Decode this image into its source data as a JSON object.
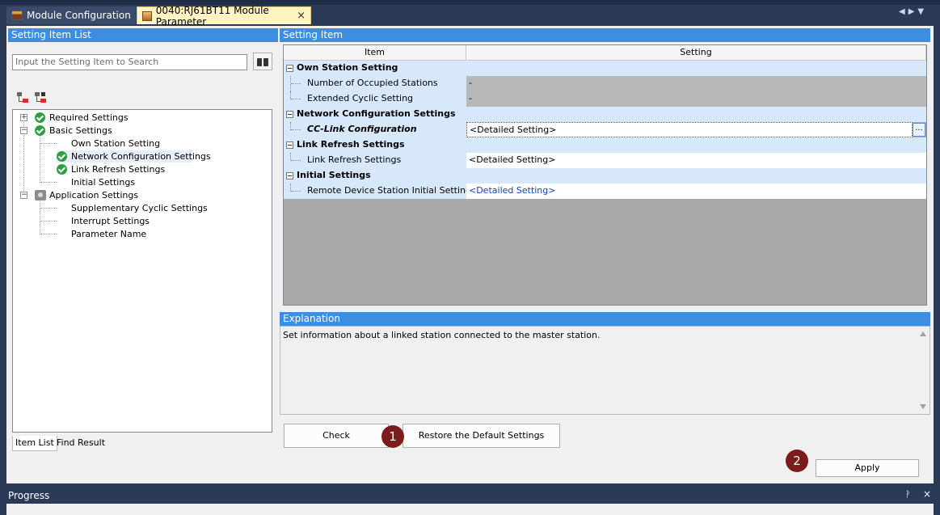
{
  "tabs": [
    {
      "label": "Module Configuration",
      "active": false
    },
    {
      "label": "0040:RJ61BT11 Module Parameter",
      "active": true,
      "close": "×"
    }
  ],
  "left_panel": {
    "title": "Setting Item List",
    "search_placeholder": "Input the Setting Item to Search",
    "tree": [
      {
        "label": "Required Settings",
        "status": "check"
      },
      {
        "label": "Basic Settings",
        "status": "check"
      },
      {
        "label": "Own Station Setting"
      },
      {
        "label": "Network Configuration Settings",
        "status": "check",
        "selected": true
      },
      {
        "label": "Link Refresh Settings",
        "status": "check"
      },
      {
        "label": "Initial Settings"
      },
      {
        "label": "Application Settings",
        "status": "gear"
      },
      {
        "label": "Supplementary Cyclic Settings"
      },
      {
        "label": "Interrupt Settings"
      },
      {
        "label": "Parameter Name"
      }
    ],
    "bottom_tabs": [
      "Item List",
      "Find Result"
    ]
  },
  "setting_item": {
    "title": "Setting Item",
    "columns": [
      "Item",
      "Setting"
    ],
    "rows": [
      {
        "item": "Own Station Setting",
        "setting": "",
        "category": true
      },
      {
        "item": "Number of Occupied Stations",
        "setting": "-"
      },
      {
        "item": "Extended Cyclic Setting",
        "setting": "-"
      },
      {
        "item": "Network Configuration Settings",
        "setting": "",
        "category": true
      },
      {
        "item": "CC-Link Configuration",
        "setting": "<Detailed Setting>"
      },
      {
        "item": "Link Refresh Settings",
        "setting": "",
        "category": true
      },
      {
        "item": "Link Refresh Settings",
        "setting": "<Detailed Setting>"
      },
      {
        "item": "Initial Settings",
        "setting": "",
        "category": true
      },
      {
        "item": "Remote Device Station Initial Settings",
        "setting": "<Detailed Setting>"
      }
    ],
    "ellipsis": "..."
  },
  "explanation": {
    "title": "Explanation",
    "text": "Set information about a linked station connected to the master station."
  },
  "buttons": {
    "check": "Check",
    "restore": "Restore the Default Settings",
    "apply": "Apply"
  },
  "badges": [
    "1",
    "2"
  ],
  "progress": {
    "title": "Progress",
    "pin": "ᚹ",
    "close": "×"
  }
}
